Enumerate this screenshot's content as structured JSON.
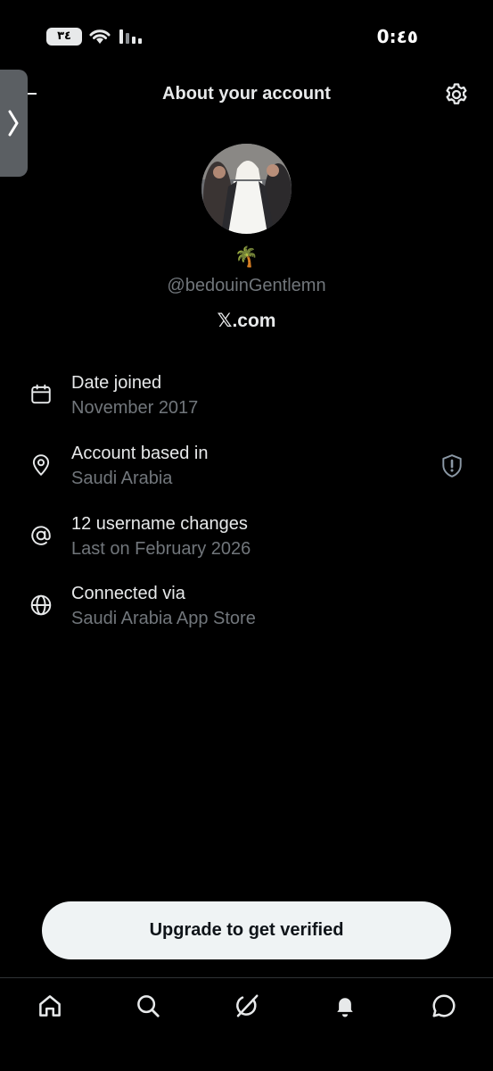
{
  "status_bar": {
    "battery": "٣٤",
    "time": "0:٤٥"
  },
  "header": {
    "title": "About your account"
  },
  "profile": {
    "emoji": "🌴",
    "handle": "@bedouinGentlemn",
    "site": "𝕏.com"
  },
  "info": [
    {
      "icon": "calendar-icon",
      "title": "Date joined",
      "value": "November 2017"
    },
    {
      "icon": "location-pin-icon",
      "title": "Account based in",
      "value": "Saudi Arabia"
    },
    {
      "icon": "at-sign-icon",
      "title": "12 username changes",
      "value": "Last on February 2026"
    },
    {
      "icon": "globe-icon",
      "title": "Connected via",
      "value": "Saudi Arabia App Store"
    }
  ],
  "upgrade_label": "Upgrade to get verified",
  "nav": [
    "home-icon",
    "search-icon",
    "grok-icon",
    "notifications-bell-icon",
    "messages-icon"
  ],
  "colors": {
    "background": "#000000",
    "primary_text": "#e7e9ea",
    "secondary_text": "#71767b",
    "button_bg": "#eff3f4"
  }
}
